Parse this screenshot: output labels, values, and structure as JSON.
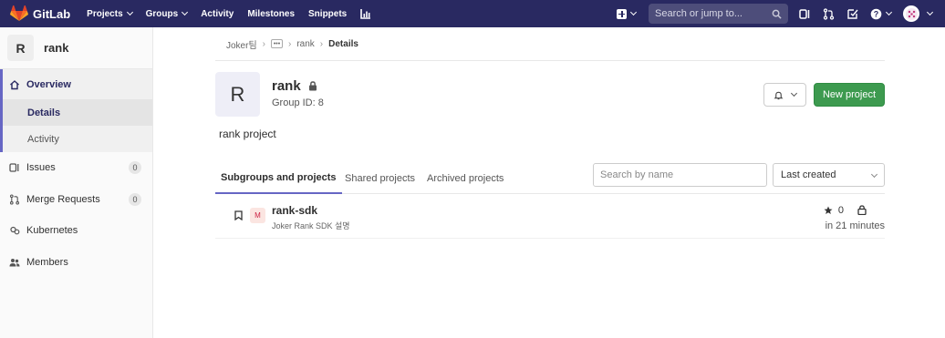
{
  "navbar": {
    "brand": "GitLab",
    "links": [
      {
        "label": "Projects",
        "dropdown": true
      },
      {
        "label": "Groups",
        "dropdown": true
      },
      {
        "label": "Activity",
        "dropdown": false
      },
      {
        "label": "Milestones",
        "dropdown": false
      },
      {
        "label": "Snippets",
        "dropdown": false
      }
    ],
    "search_placeholder": "Search or jump to..."
  },
  "sidebar": {
    "avatar_letter": "R",
    "group_name": "rank",
    "overview_label": "Overview",
    "sub_items": [
      "Details",
      "Activity"
    ],
    "items": [
      {
        "label": "Issues",
        "count": "0",
        "icon": "issues-icon"
      },
      {
        "label": "Merge Requests",
        "count": "0",
        "icon": "merge-request-icon"
      },
      {
        "label": "Kubernetes",
        "count": null,
        "icon": "kubernetes-icon"
      },
      {
        "label": "Members",
        "count": null,
        "icon": "members-icon"
      }
    ]
  },
  "breadcrumb": {
    "root": "Joker팀",
    "group": "rank",
    "current": "Details"
  },
  "group": {
    "avatar_letter": "R",
    "name": "rank",
    "group_id": "Group ID: 8",
    "description": "rank project",
    "new_project_label": "New project"
  },
  "tabs": [
    "Subgroups and projects",
    "Shared projects",
    "Archived projects"
  ],
  "filter": {
    "search_placeholder": "Search by name",
    "sort_selected": "Last created"
  },
  "projects": [
    {
      "avatar_letter": "M",
      "name": "rank-sdk",
      "description": "Joker Rank SDK 설명",
      "stars": "0",
      "updated": "in 21 minutes"
    }
  ],
  "colors": {
    "navbar_bg": "#292961",
    "accent": "#6666c4",
    "new_project_green": "#3d9a4f"
  }
}
